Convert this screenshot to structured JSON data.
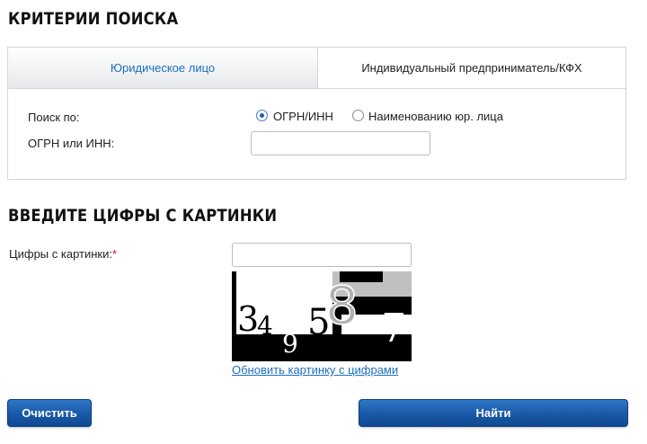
{
  "search_criteria": {
    "title": "КРИТЕРИИ ПОИСКА",
    "tabs": [
      {
        "label": "Юридическое лицо",
        "active": true
      },
      {
        "label": "Индивидуальный предприниматель/КФХ",
        "active": false
      }
    ],
    "search_by_label": "Поиск по:",
    "search_by_options": [
      {
        "label": "ОГРН/ИНН",
        "checked": true
      },
      {
        "label": "Наименованию юр. лица",
        "checked": false
      }
    ],
    "ogrn_inn_label": "ОГРН или ИНН:",
    "ogrn_inn_value": ""
  },
  "captcha": {
    "title": "ВВЕДИТЕ ЦИФРЫ С КАРТИНКИ",
    "field_label": "Цифры с картинки:",
    "required_mark": "*",
    "input_value": "",
    "image_digits": [
      "3",
      "4",
      "9",
      "5",
      "8",
      "7"
    ],
    "refresh_link": "Обновить картинку с цифрами"
  },
  "actions": {
    "clear_label": "Очистить",
    "find_label": "Найти"
  },
  "colors": {
    "accent": "#1b6fc1",
    "button": "#1958a6",
    "required": "#c8102e",
    "border": "#d2d6da"
  }
}
